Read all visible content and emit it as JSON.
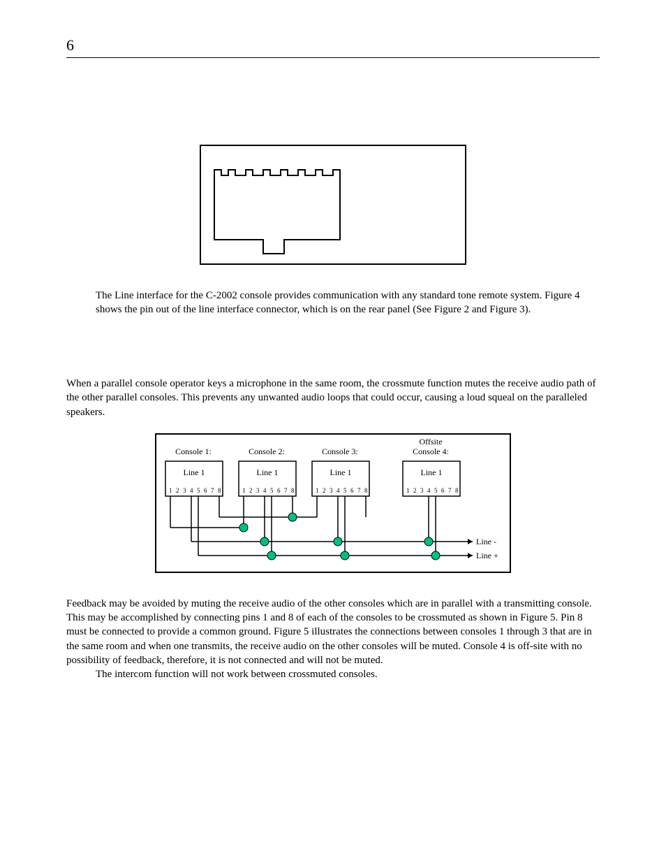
{
  "page_number": "6",
  "paragraphs": {
    "p1": "The Line interface for the C-2002 console provides communication with any standard tone remote system. Figure 4 shows the pin out of the line interface connector, which is on the rear panel (See Figure 2 and Figure 3).",
    "p2": "When a parallel console operator keys a microphone in the same room, the crossmute function mutes the receive audio path of the other parallel consoles. This prevents any unwanted audio loops that could occur, causing a loud squeal on the paralleled speakers.",
    "p3": "Feedback may be avoided by muting the receive audio of the other consoles which are in parallel with a transmitting console.  This may be accomplished by connecting pins 1 and 8 of each of the consoles to be crossmuted as shown in Figure 5.  Pin 8 must be connected to provide a common ground. Figure 5 illustrates the connections between consoles 1 through 3 that are in the same room and when one transmits, the receive audio on the other consoles will be muted.  Console 4 is off-site with no possibility of feedback, therefore, it is not connected and will not be muted.",
    "p4": "The intercom function will not work between crossmuted consoles."
  },
  "fig_crossmute": {
    "offsite_label": "Offsite",
    "consoles": {
      "c1": "Console 1:",
      "c2": "Console 2:",
      "c3": "Console 3:",
      "c4": "Console 4:"
    },
    "line_label": "Line 1",
    "pins": {
      "p1": "1",
      "p2": "2",
      "p3": "3",
      "p4": "4",
      "p5": "5",
      "p6": "6",
      "p7": "7",
      "p8": "8"
    },
    "line_minus": "Line -",
    "line_plus": "Line +"
  }
}
